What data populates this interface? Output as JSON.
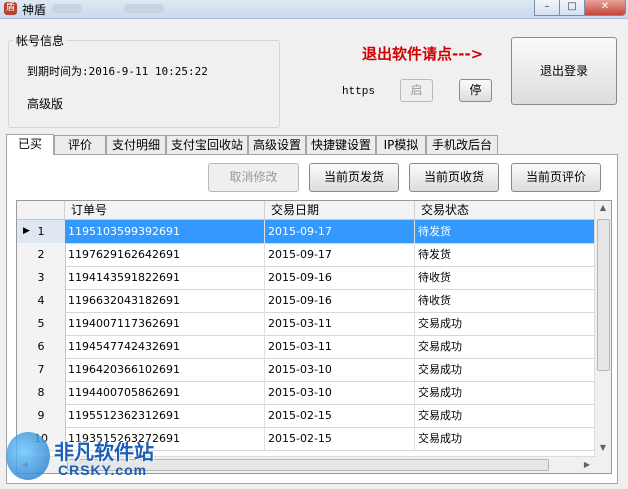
{
  "window": {
    "title": "神盾",
    "icon": "shield-app-icon"
  },
  "account": {
    "group_title": "帐号信息",
    "expire_text": "到期时间为:2016-9-11 10:25:22",
    "edition": "高级版"
  },
  "exit": {
    "hint": "退出软件请点--->",
    "logout_label": "退出登录"
  },
  "https": {
    "label": "https",
    "start_label": "启",
    "stop_label": "停"
  },
  "tabs": [
    {
      "label": "已买",
      "active": true
    },
    {
      "label": "评价"
    },
    {
      "label": "支付明细"
    },
    {
      "label": "支付宝回收站"
    },
    {
      "label": "高级设置"
    },
    {
      "label": "快捷键设置"
    },
    {
      "label": "IP模拟"
    },
    {
      "label": "手机改后台"
    }
  ],
  "toolbar": {
    "cancel_edit": "取消修改",
    "ship_page": "当前页发货",
    "receive_page": "当前页收货",
    "review_page": "当前页评价"
  },
  "table": {
    "columns": [
      "订单号",
      "交易日期",
      "交易状态"
    ],
    "rows": [
      {
        "num": "1",
        "order": "1195103599392691",
        "date": "2015-09-17",
        "status": "待发货",
        "selected": true
      },
      {
        "num": "2",
        "order": "1197629162642691",
        "date": "2015-09-17",
        "status": "待发货"
      },
      {
        "num": "3",
        "order": "1194143591822691",
        "date": "2015-09-16",
        "status": "待收货"
      },
      {
        "num": "4",
        "order": "1196632043182691",
        "date": "2015-09-16",
        "status": "待收货"
      },
      {
        "num": "5",
        "order": "1194007117362691",
        "date": "2015-03-11",
        "status": "交易成功"
      },
      {
        "num": "6",
        "order": "1194547742432691",
        "date": "2015-03-11",
        "status": "交易成功"
      },
      {
        "num": "7",
        "order": "1196420366102691",
        "date": "2015-03-10",
        "status": "交易成功"
      },
      {
        "num": "8",
        "order": "1194400705862691",
        "date": "2015-03-10",
        "status": "交易成功"
      },
      {
        "num": "9",
        "order": "1195512362312691",
        "date": "2015-02-15",
        "status": "交易成功"
      },
      {
        "num": "10",
        "order": "1193515263272691",
        "date": "2015-02-15",
        "status": "交易成功"
      }
    ]
  },
  "watermark": {
    "name": "非凡软件站",
    "site": "CRSKY.com"
  }
}
